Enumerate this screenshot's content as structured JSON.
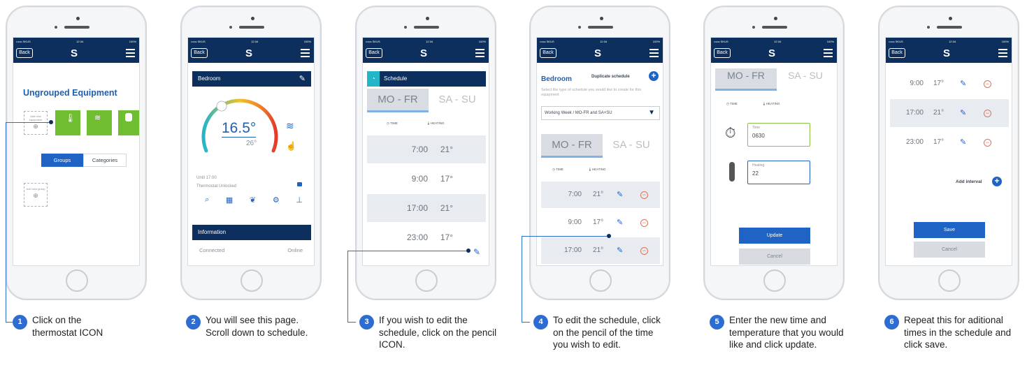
{
  "colors": {
    "navy": "#0d2f5e",
    "blue": "#1f64c4",
    "green": "#6ebe2f",
    "minus_red": "#e2725b",
    "step_blue": "#2d6cd1"
  },
  "common": {
    "back_label": "Back",
    "logo_glyph": "S",
    "status_left": "•••oo SKUS",
    "status_time": "12:34",
    "status_right": "100%"
  },
  "phone1": {
    "title": "Ungrouped Equipment",
    "add_equipment": "Add new equipment",
    "tiles": [
      "thermostat",
      "wifi",
      "plug",
      "socket"
    ],
    "tab_groups": "Groups",
    "tab_categories": "Categories",
    "add_group": "Add new group"
  },
  "phone2": {
    "header": "Bedroom",
    "temp_current": "16.5°",
    "temp_target": "26°",
    "until": "Until 17:00",
    "lock_state": "Thermostat Unlocked",
    "info_header": "Information",
    "connected_label": "Connected",
    "connected_value": "Online"
  },
  "phone3": {
    "header": "Schedule",
    "tab_active": "MO - FR",
    "tab_inactive": "SA - SU",
    "col_time": "TIME",
    "col_heating": "HEATING",
    "rows": [
      {
        "time": "7:00",
        "temp": "21°"
      },
      {
        "time": "9:00",
        "temp": "17°"
      },
      {
        "time": "17:00",
        "temp": "21°"
      },
      {
        "time": "23:00",
        "temp": "17°"
      }
    ]
  },
  "phone4": {
    "title": "Bedroom",
    "dup": "Duplicate schedule",
    "hint": "Select the type of schedule you would like to create for this equipment",
    "select_value": "Working Week / MO-FR and SA+SU",
    "tab_active": "MO - FR",
    "tab_inactive": "SA - SU",
    "col_time": "TIME",
    "col_heating": "HEATING",
    "rows": [
      {
        "time": "7:00",
        "temp": "21°"
      },
      {
        "time": "9:00",
        "temp": "17°"
      },
      {
        "time": "17:00",
        "temp": "21°"
      }
    ]
  },
  "phone5": {
    "tab_active": "MO - FR",
    "tab_inactive": "SA - SU",
    "col_time": "TIME",
    "col_heating": "HEATING",
    "time_label": "Time",
    "time_value": "0630",
    "heating_label": "Heating",
    "heating_value": "22",
    "update": "Update",
    "cancel": "Cancel"
  },
  "phone6": {
    "rows": [
      {
        "time": "9:00",
        "temp": "17°"
      },
      {
        "time": "17:00",
        "temp": "21°"
      },
      {
        "time": "23:00",
        "temp": "17°"
      }
    ],
    "add_interval": "Add interval",
    "save": "Save",
    "cancel": "Cancel"
  },
  "steps": [
    {
      "num": "1",
      "text": "Click on the thermostat ICON"
    },
    {
      "num": "2",
      "text": "You will see this page. Scroll down to schedule."
    },
    {
      "num": "3",
      "text": "If you wish to edit the schedule, click on the pencil ICON."
    },
    {
      "num": "4",
      "text": "To edit the schedule, click on the pencil of the time you wish to edit."
    },
    {
      "num": "5",
      "text": "Enter the new time and temperature that you would like and click update."
    },
    {
      "num": "6",
      "text": "Repeat this for aditional times in the schedule and click save."
    }
  ]
}
